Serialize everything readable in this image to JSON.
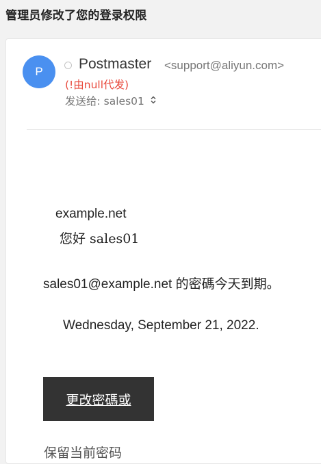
{
  "subject": "管理员修改了您的登录权限",
  "sender": {
    "avatar_letter": "P",
    "name": "Postmaster",
    "email": "<support@aliyun.com>",
    "proxy_note": "(!由null代发)"
  },
  "recipient": {
    "label": "发送给: sales01",
    "chevron_icon": "chevron-up-down-icon"
  },
  "body": {
    "domain": "example.net",
    "greeting": "您好 sales01",
    "expiry_email": "sales01@example.net",
    "expiry_message": "的密碼今天到期。",
    "date": "Wednesday, September 21, 2022.",
    "button_label": "更改密碼或",
    "keep_password": "保留当前密码"
  },
  "colors": {
    "avatar": "#4a90f0",
    "warning": "#e8483b",
    "button": "#333333"
  }
}
